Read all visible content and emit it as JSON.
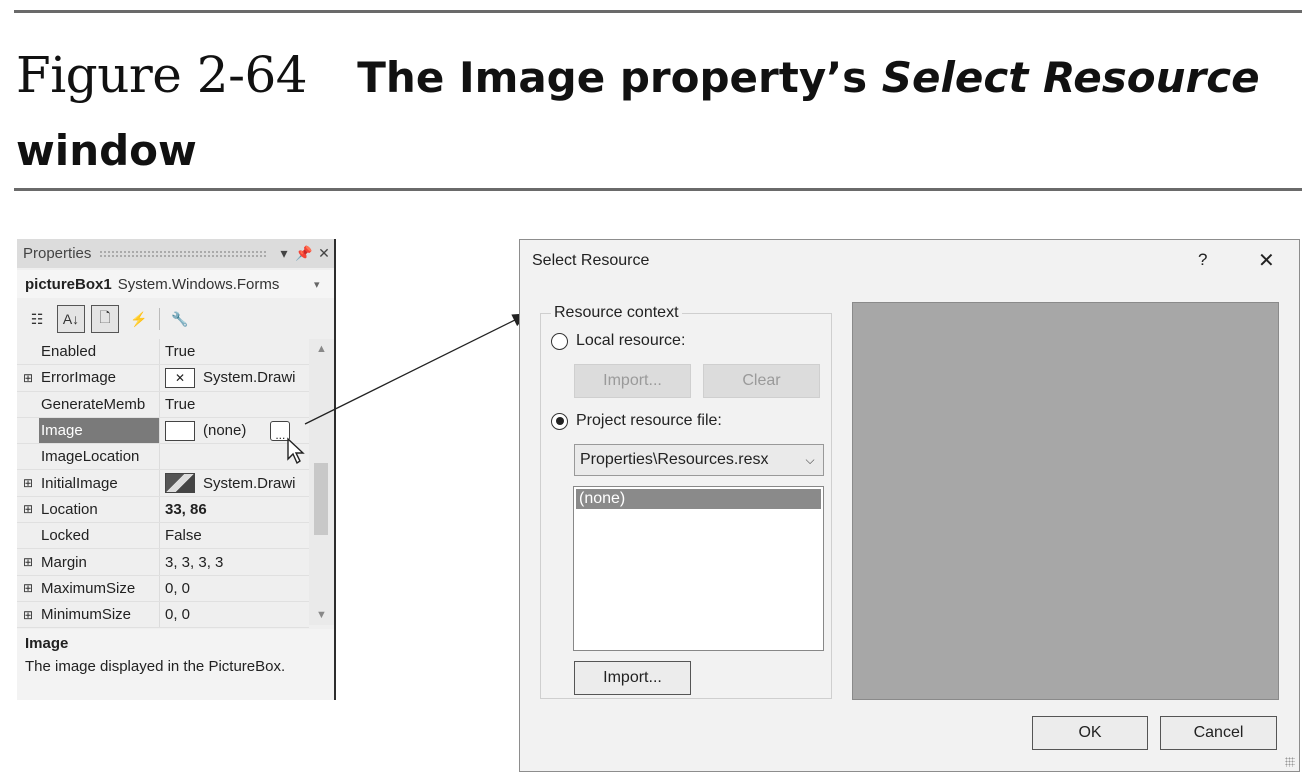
{
  "figure": {
    "number": "Figure 2-64",
    "caption_pre": "The Image property’s ",
    "caption_em": "Select Resource",
    "caption_post": " window"
  },
  "properties": {
    "title": "Properties",
    "object_name": "pictureBox1",
    "object_type": "System.Windows.Forms",
    "rows": [
      {
        "expander": "",
        "name": "Enabled",
        "value": "True"
      },
      {
        "expander": "⊞",
        "name": "ErrorImage",
        "value": "System.Drawi"
      },
      {
        "expander": "",
        "name": "GenerateMemb",
        "value": "True"
      },
      {
        "expander": "",
        "name": "Image",
        "value": "(none)"
      },
      {
        "expander": "",
        "name": "ImageLocation",
        "value": ""
      },
      {
        "expander": "⊞",
        "name": "InitialImage",
        "value": "System.Drawi"
      },
      {
        "expander": "⊞",
        "name": "Location",
        "value": "33, 86"
      },
      {
        "expander": "",
        "name": "Locked",
        "value": "False"
      },
      {
        "expander": "⊞",
        "name": "Margin",
        "value": "3, 3, 3, 3"
      },
      {
        "expander": "⊞",
        "name": "MaximumSize",
        "value": "0, 0"
      },
      {
        "expander": "⊞",
        "name": "MinimumSize",
        "value": "0, 0"
      }
    ],
    "ellipsis": "...",
    "description_title": "Image",
    "description_text": "The image displayed in the PictureBox."
  },
  "dialog": {
    "title": "Select Resource",
    "help": "?",
    "close": "✕",
    "group_label": "Resource context",
    "local_label": "Local resource:",
    "import_disabled": "Import...",
    "clear": "Clear",
    "project_label": "Project resource file:",
    "combo_value": "Properties\\Resources.resx",
    "list_items": [
      "(none)"
    ],
    "import": "Import...",
    "ok": "OK",
    "cancel": "Cancel"
  }
}
